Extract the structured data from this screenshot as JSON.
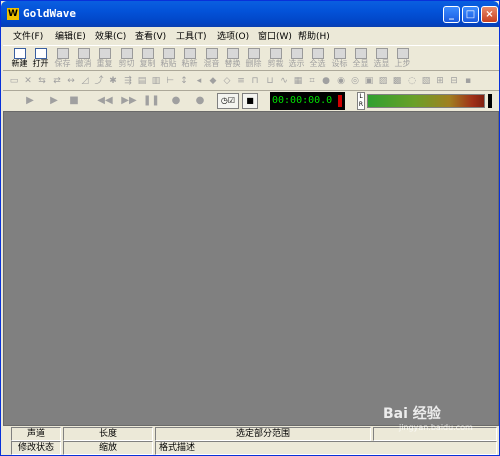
{
  "window": {
    "title": "GoldWave",
    "app_icon_letter": "W",
    "min": "_",
    "max": "□",
    "close": "×"
  },
  "menu": [
    "文件(F)",
    "编辑(E)",
    "效果(C)",
    "查看(V)",
    "工具(T)",
    "选项(O)",
    "窗口(W)",
    "帮助(H)"
  ],
  "toolbar": [
    {
      "label": "新建",
      "icon": "new-icon",
      "enabled": true
    },
    {
      "label": "打开",
      "icon": "open-icon",
      "enabled": true
    },
    {
      "label": "保存",
      "icon": "save-icon",
      "enabled": false
    },
    {
      "label": "撤消",
      "icon": "undo-icon",
      "enabled": false
    },
    {
      "label": "重复",
      "icon": "redo-icon",
      "enabled": false
    },
    {
      "label": "剪切",
      "icon": "cut-icon",
      "enabled": false
    },
    {
      "label": "复制",
      "icon": "copy-icon",
      "enabled": false
    },
    {
      "label": "粘贴",
      "icon": "paste-icon",
      "enabled": false
    },
    {
      "label": "粘新",
      "icon": "paste-new-icon",
      "enabled": false
    },
    {
      "label": "混音",
      "icon": "mix-icon",
      "enabled": false
    },
    {
      "label": "替换",
      "icon": "replace-icon",
      "enabled": false
    },
    {
      "label": "删除",
      "icon": "delete-icon",
      "enabled": false
    },
    {
      "label": "剪裁",
      "icon": "trim-icon",
      "enabled": false
    },
    {
      "label": "选示",
      "icon": "select-view-icon",
      "enabled": false
    },
    {
      "label": "全选",
      "icon": "select-all-icon",
      "enabled": false
    },
    {
      "label": "设标",
      "icon": "set-marker-icon",
      "enabled": false
    },
    {
      "label": "全显",
      "icon": "show-all-icon",
      "enabled": false
    },
    {
      "label": "选显",
      "icon": "zoom-selection-icon",
      "enabled": false
    },
    {
      "label": "上步",
      "icon": "previous-icon",
      "enabled": false
    }
  ],
  "effects_toolbar_count": 33,
  "transport": {
    "play": "▶",
    "play_selection": "▶",
    "stop": "■",
    "rewind": "◀◀",
    "forward": "▶▶",
    "pause": "❚❚",
    "record": "●",
    "record_alt": "●",
    "loop_label": "◷☑",
    "box_label": "■",
    "time": "00:00:00.0",
    "meter_label": "L R"
  },
  "status_row1": [
    "声道",
    "长度",
    "选定部分范围"
  ],
  "status_row2": [
    "修改状态",
    "缩放",
    "格式描述"
  ],
  "watermark": {
    "text": "Bai 经验",
    "url": "jingyan.baidu.com"
  }
}
